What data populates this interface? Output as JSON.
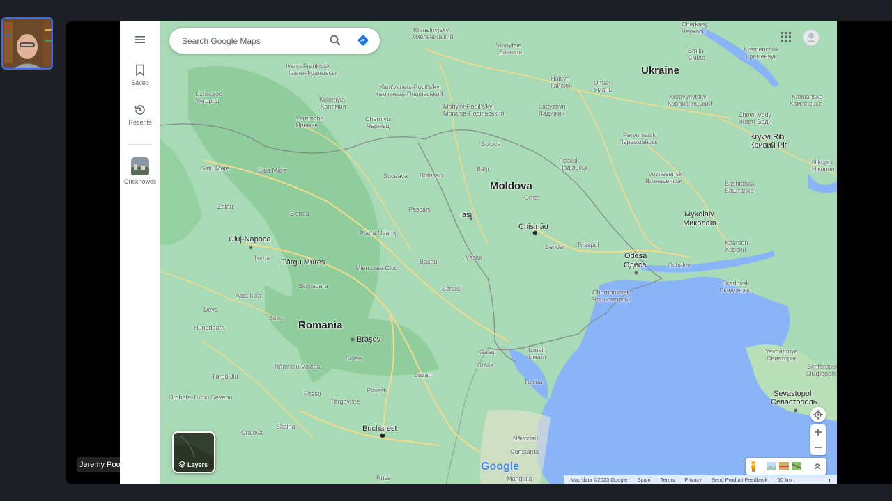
{
  "participant": {
    "name": "Jeremy Poole"
  },
  "rail": {
    "saved_label": "Saved",
    "recents_label": "Recents",
    "recent_place_label": "Crickhowell"
  },
  "search": {
    "placeholder": "Search Google Maps"
  },
  "layers": {
    "label": "Layers"
  },
  "logo": "Google",
  "attribution": {
    "map_data": "Map data ©2023 Google",
    "region": "Spain",
    "terms": "Terms",
    "privacy": "Privacy",
    "feedback": "Send Product Feedback",
    "scale": "50 km"
  },
  "colors": {
    "land": "#a8dab5",
    "forest": "#8fce9c",
    "water": "#8ab4f8",
    "border": "#80868b",
    "road": "#f7d98b",
    "accent": "#1a73e8"
  },
  "places": {
    "countries": [
      {
        "name": "Ukraine"
      },
      {
        "name": "Moldova"
      },
      {
        "name": "Romania"
      }
    ],
    "cities": [
      "Cherkasy",
      "Черкаси",
      "Khmelnytskyi",
      "Хмельницький",
      "Vinnytsia",
      "Вінниця",
      "Kremenchuk",
      "Кременчук",
      "Smila",
      "Сміла",
      "Ivano-Frankivsk",
      "Івано-Франківськ",
      "Haisyn",
      "Гайсин",
      "Uman",
      "Умань",
      "Uzhhorod",
      "Ужгород",
      "Kam'yanets-Podil's'kyi",
      "Кам'янець-Подільський",
      "Kolomyia",
      "Коломия",
      "Mohyliv-Podil's'kyi",
      "Могилів-Подільський",
      "Ladyzhyn",
      "Ладижин",
      "Kropyvnytskyi",
      "Кропивницький",
      "Kamianske",
      "Кам'янське",
      "Yaremche",
      "Яремче",
      "Chernivtsi",
      "Чернівці",
      "Zhovti Vody",
      "Жовті Води",
      "Pervomaisk",
      "Первомайськ",
      "Kryvyi Rih",
      "Кривий Ріг",
      "Soroca",
      "Podilsk",
      "Подільськ",
      "Bălți",
      "Suceava",
      "Botoșani",
      "Voznesensk",
      "Вознесенськ",
      "Bashtanka",
      "Баштанка",
      "Satu Mare",
      "Baia Mare",
      "Nikopol",
      "Нікопол",
      "Orhei",
      "Pașcani",
      "Bistrița",
      "Zalău",
      "Iași",
      "Mykolaiv",
      "Миколаїв",
      "Chișinău",
      "Piatra Neamț",
      "Cluj-Napoca",
      "Tiraspol",
      "Bender",
      "Kherson",
      "Херсон",
      "Odesa",
      "Одеса",
      "Ochakiv",
      "Turda",
      "Târgu Mureș",
      "Bacău",
      "Vaslui",
      "Miercurea Ciuc",
      "Chornomorsk",
      "Чорноморськ",
      "Skadovsk",
      "Скадовськ",
      "Sighișoara",
      "Bârlad",
      "Alba Iulia",
      "Deva",
      "Hunedoara",
      "Sibiu",
      "Brașov",
      "Yevpatoriya",
      "Євпаторія",
      "Simferopol",
      "Сімферополь",
      "Galați",
      "Izmail",
      "Ізмаїл",
      "Brăila",
      "Sinaia",
      "Râmnicu Vâlcea",
      "Târgu Jiu",
      "Buzău",
      "Tulcea",
      "Drobeta-Turnu Severin",
      "Pitești",
      "Ploiești",
      "Târgoviște",
      "Sevastopol",
      "Севастополь",
      "Slatina",
      "Craiova",
      "Bucharest",
      "Năvodari",
      "Constanța",
      "Mangalia",
      "Ruse"
    ]
  }
}
